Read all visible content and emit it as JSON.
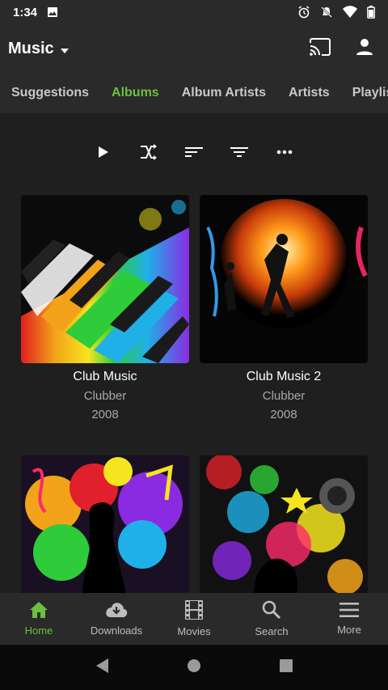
{
  "status_bar": {
    "time": "1:34"
  },
  "app_bar": {
    "title": "Music"
  },
  "tabs": [
    {
      "label": "Suggestions"
    },
    {
      "label": "Albums"
    },
    {
      "label": "Album Artists"
    },
    {
      "label": "Artists"
    },
    {
      "label": "Playlists"
    }
  ],
  "albums": [
    {
      "title": "Club Music",
      "artist": "Clubber",
      "year": "2008"
    },
    {
      "title": "Club Music 2",
      "artist": "Clubber",
      "year": "2008"
    }
  ],
  "bottom_nav": [
    {
      "label": "Home"
    },
    {
      "label": "Downloads"
    },
    {
      "label": "Movies"
    },
    {
      "label": "Search"
    },
    {
      "label": "More"
    }
  ],
  "colors": {
    "accent": "#6fbf3f",
    "background": "#1f1f1f",
    "bar": "#2a2a2a"
  }
}
